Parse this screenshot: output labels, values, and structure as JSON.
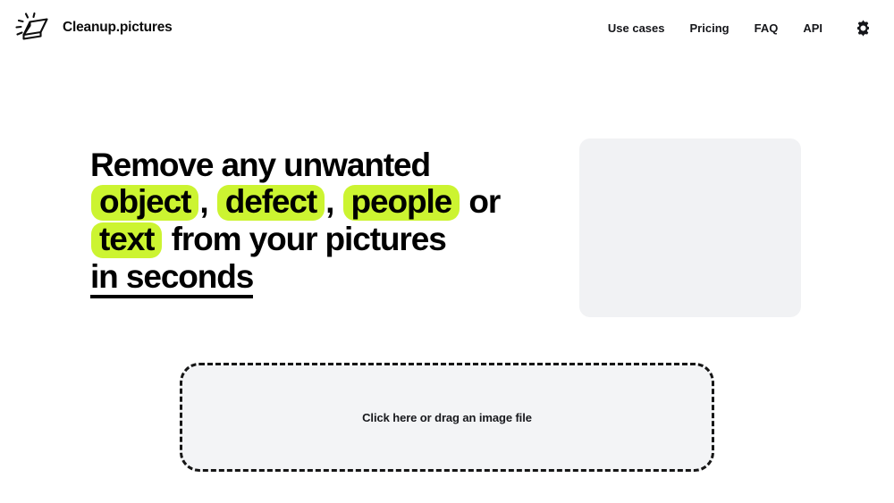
{
  "header": {
    "brand": {
      "icon": "eraser-icon",
      "name": "Cleanup.pictures"
    },
    "nav": [
      {
        "label": "Use cases"
      },
      {
        "label": "Pricing"
      },
      {
        "label": "FAQ"
      },
      {
        "label": "API"
      }
    ],
    "settings_icon": "gear-icon"
  },
  "hero": {
    "headline": {
      "line1_prefix": "Remove any unwanted",
      "highlight1": "object",
      "sep1": ",",
      "highlight2": "defect",
      "sep2": ",",
      "highlight3": "people",
      "conjunction": "or",
      "highlight4": "text",
      "middle": "from your pictures",
      "underlined": "in seconds"
    },
    "media_placeholder": "image-preview-placeholder"
  },
  "dropzone": {
    "label": "Click here or drag an image file"
  },
  "colors": {
    "highlight": "#ccf431",
    "text": "#000000",
    "placeholder_bg": "#f1f2f4",
    "dropzone_bg": "#f3f4f6",
    "dropzone_border": "#161616",
    "page_bg": "#ffffff"
  }
}
